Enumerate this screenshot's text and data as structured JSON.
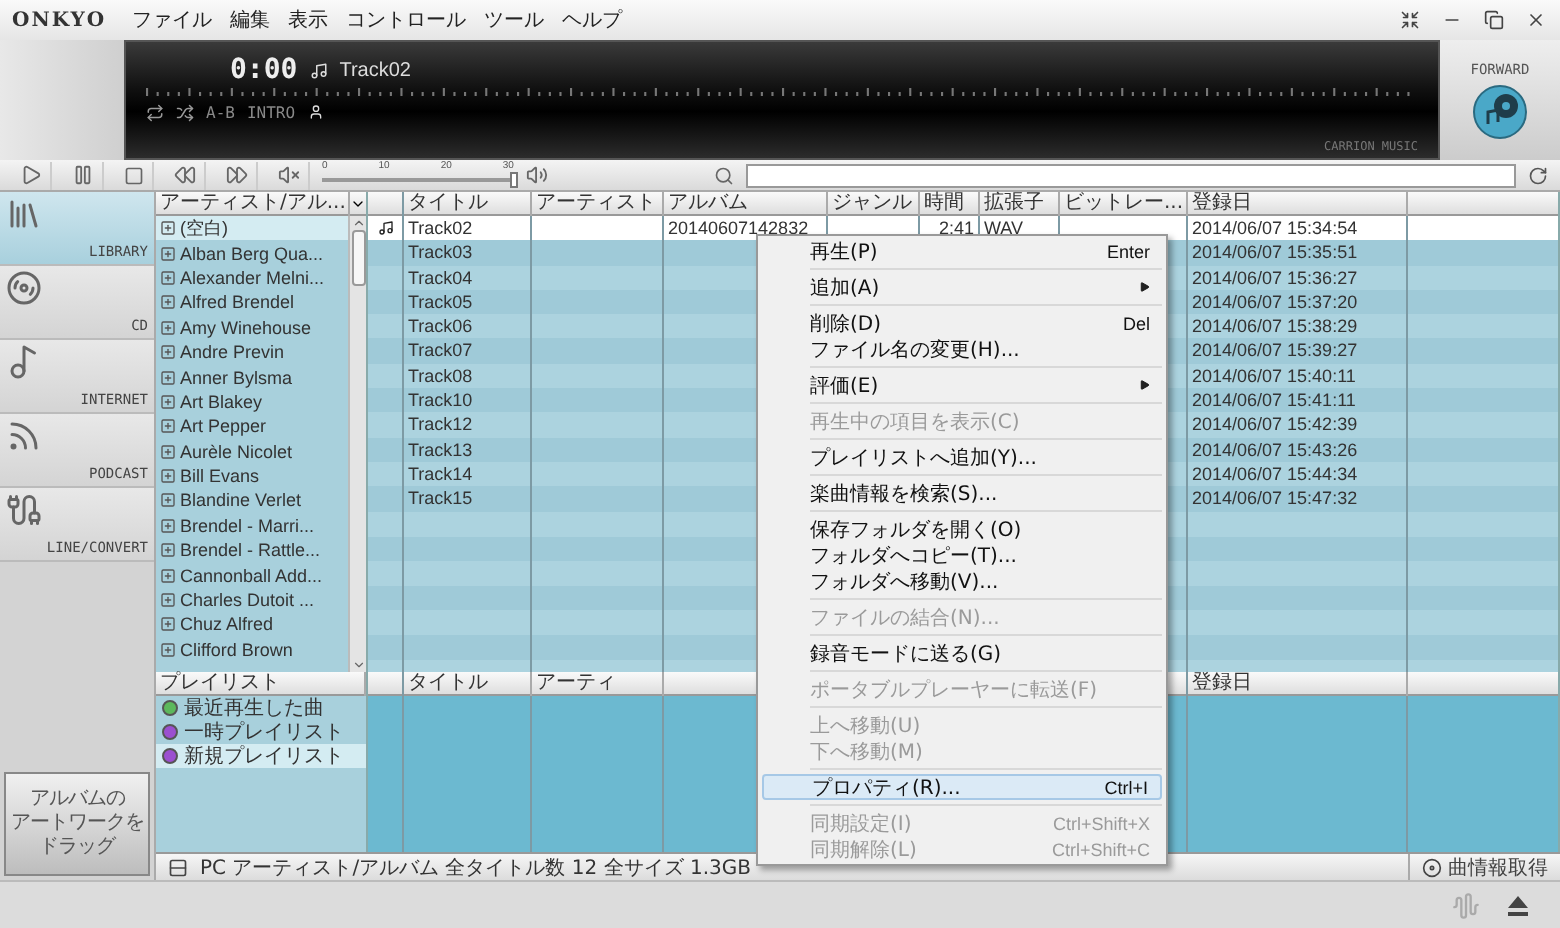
{
  "window": {
    "logo": "ONKYO",
    "menu": [
      "ファイル",
      "編集",
      "表示",
      "コントロール",
      "ツール",
      "ヘルプ"
    ]
  },
  "display": {
    "time": "0:00",
    "track": "Track02",
    "modes": [
      "A-B",
      "INTRO"
    ],
    "brand": "CARRION MUSIC"
  },
  "forward_logo": {
    "label": "FORWARD"
  },
  "toolbar": {
    "volume": {
      "ticks": [
        "0",
        "10",
        "20",
        "30"
      ],
      "level": 1
    }
  },
  "nav": {
    "items": [
      {
        "kind": "library",
        "label": "LIBRARY",
        "selected": true
      },
      {
        "kind": "cd",
        "label": "CD",
        "selected": false
      },
      {
        "kind": "internet",
        "label": "INTERNET",
        "selected": false
      },
      {
        "kind": "podcast",
        "label": "PODCAST",
        "selected": false
      },
      {
        "kind": "line",
        "label": "LINE/CONVERT",
        "selected": false
      }
    ]
  },
  "artwork_drop": {
    "lines": [
      "アルバムの",
      "アートワークを",
      "ドラッグ"
    ]
  },
  "artist_list": {
    "header": "アーティスト/アル...",
    "items": [
      {
        "label": "(空白)",
        "selected": true
      },
      {
        "label": "Alban Berg Qua...",
        "selected": false
      },
      {
        "label": "Alexander Melni...",
        "selected": false
      },
      {
        "label": "Alfred Brendel",
        "selected": false
      },
      {
        "label": "Amy Winehouse",
        "selected": false
      },
      {
        "label": "Andre Previn",
        "selected": false
      },
      {
        "label": "Anner Bylsma",
        "selected": false
      },
      {
        "label": "Art Blakey",
        "selected": false
      },
      {
        "label": "Art Pepper",
        "selected": false
      },
      {
        "label": "Aurèle Nicolet",
        "selected": false
      },
      {
        "label": "Bill Evans",
        "selected": false
      },
      {
        "label": "Blandine Verlet",
        "selected": false
      },
      {
        "label": "Brendel - Marri...",
        "selected": false
      },
      {
        "label": "Brendel - Rattle...",
        "selected": false
      },
      {
        "label": "Cannonball Add...",
        "selected": false
      },
      {
        "label": "Charles Dutoit ...",
        "selected": false
      },
      {
        "label": "Chuz Alfred",
        "selected": false
      },
      {
        "label": "Clifford Brown",
        "selected": false
      }
    ]
  },
  "track_table": {
    "columns": [
      "タイトル",
      "アーティスト",
      "アルバム",
      "ジャンル",
      "時間",
      "拡張子",
      "ビットレー...",
      "登録日"
    ],
    "rows": [
      {
        "title": "Track02",
        "album": "20140607142832",
        "time": "2:41",
        "ext": "WAV",
        "date": "2014/06/07 15:34:54",
        "selected": true,
        "playing": true
      },
      {
        "title": "Track03",
        "date": "2014/06/07 15:35:51",
        "selected": false,
        "playing": false
      },
      {
        "title": "Track04",
        "date": "2014/06/07 15:36:27",
        "selected": false,
        "playing": false
      },
      {
        "title": "Track05",
        "date": "2014/06/07 15:37:20",
        "selected": false,
        "playing": false
      },
      {
        "title": "Track06",
        "date": "2014/06/07 15:38:29",
        "selected": false,
        "playing": false
      },
      {
        "title": "Track07",
        "date": "2014/06/07 15:39:27",
        "selected": false,
        "playing": false
      },
      {
        "title": "Track08",
        "date": "2014/06/07 15:40:11",
        "selected": false,
        "playing": false
      },
      {
        "title": "Track10",
        "date": "2014/06/07 15:41:11",
        "selected": false,
        "playing": false
      },
      {
        "title": "Track12",
        "date": "2014/06/07 15:42:39",
        "selected": false,
        "playing": false
      },
      {
        "title": "Track13",
        "date": "2014/06/07 15:43:26",
        "selected": false,
        "playing": false
      },
      {
        "title": "Track14",
        "date": "2014/06/07 15:44:34",
        "selected": false,
        "playing": false
      },
      {
        "title": "Track15",
        "date": "2014/06/07 15:47:32",
        "selected": false,
        "playing": false
      }
    ]
  },
  "playlist": {
    "header": "プレイリスト",
    "items": [
      {
        "label": "最近再生した曲",
        "color": "#5cb85c",
        "selected": false
      },
      {
        "label": "一時プレイリスト",
        "color": "#9b4fd0",
        "selected": false
      },
      {
        "label": "新規プレイリスト",
        "color": "#9b4fd0",
        "selected": true
      }
    ]
  },
  "queue_table": {
    "columns": [
      "タイトル",
      "アーティ",
      "登録日"
    ]
  },
  "status_bar": {
    "text": "PC アーティスト/アルバム 全タイトル数 12 全サイズ 1.3GB",
    "fetch_button": "曲情報取得"
  },
  "context_menu": {
    "groups": [
      [
        {
          "label": "再生(P)",
          "shortcut": "Enter",
          "disabled": false,
          "submenu": false,
          "selected": false
        }
      ],
      [
        {
          "label": "追加(A)",
          "disabled": false,
          "submenu": true,
          "selected": false
        }
      ],
      [
        {
          "label": "削除(D)",
          "shortcut": "Del",
          "disabled": false,
          "submenu": false,
          "selected": false
        },
        {
          "label": "ファイル名の変更(H)...",
          "disabled": false,
          "submenu": false,
          "selected": false
        }
      ],
      [
        {
          "label": "評価(E)",
          "disabled": false,
          "submenu": true,
          "selected": false
        }
      ],
      [
        {
          "label": "再生中の項目を表示(C)",
          "disabled": true,
          "submenu": false,
          "selected": false
        }
      ],
      [
        {
          "label": "プレイリストへ追加(Y)...",
          "disabled": false,
          "submenu": false,
          "selected": false
        }
      ],
      [
        {
          "label": "楽曲情報を検索(S)...",
          "disabled": false,
          "submenu": false,
          "selected": false
        }
      ],
      [
        {
          "label": "保存フォルダを開く(O)",
          "disabled": false,
          "submenu": false,
          "selected": false
        },
        {
          "label": "フォルダへコピー(T)...",
          "disabled": false,
          "submenu": false,
          "selected": false
        },
        {
          "label": "フォルダへ移動(V)...",
          "disabled": false,
          "submenu": false,
          "selected": false
        }
      ],
      [
        {
          "label": "ファイルの結合(N)...",
          "disabled": true,
          "submenu": false,
          "selected": false
        }
      ],
      [
        {
          "label": "録音モードに送る(G)",
          "disabled": false,
          "submenu": false,
          "selected": false
        }
      ],
      [
        {
          "label": "ポータブルプレーヤーに転送(F)",
          "disabled": true,
          "submenu": false,
          "selected": false
        }
      ],
      [
        {
          "label": "上へ移動(U)",
          "disabled": true,
          "submenu": false,
          "selected": false
        },
        {
          "label": "下へ移動(M)",
          "disabled": true,
          "submenu": false,
          "selected": false
        }
      ],
      [
        {
          "label": "プロパティ(R)...",
          "shortcut": "Ctrl+I",
          "disabled": false,
          "submenu": false,
          "selected": true
        }
      ],
      [
        {
          "label": "同期設定(I)",
          "shortcut": "Ctrl+Shift+X",
          "disabled": true,
          "submenu": false,
          "selected": false
        },
        {
          "label": "同期解除(L)",
          "shortcut": "Ctrl+Shift+C",
          "disabled": true,
          "submenu": false,
          "selected": false
        }
      ]
    ]
  }
}
